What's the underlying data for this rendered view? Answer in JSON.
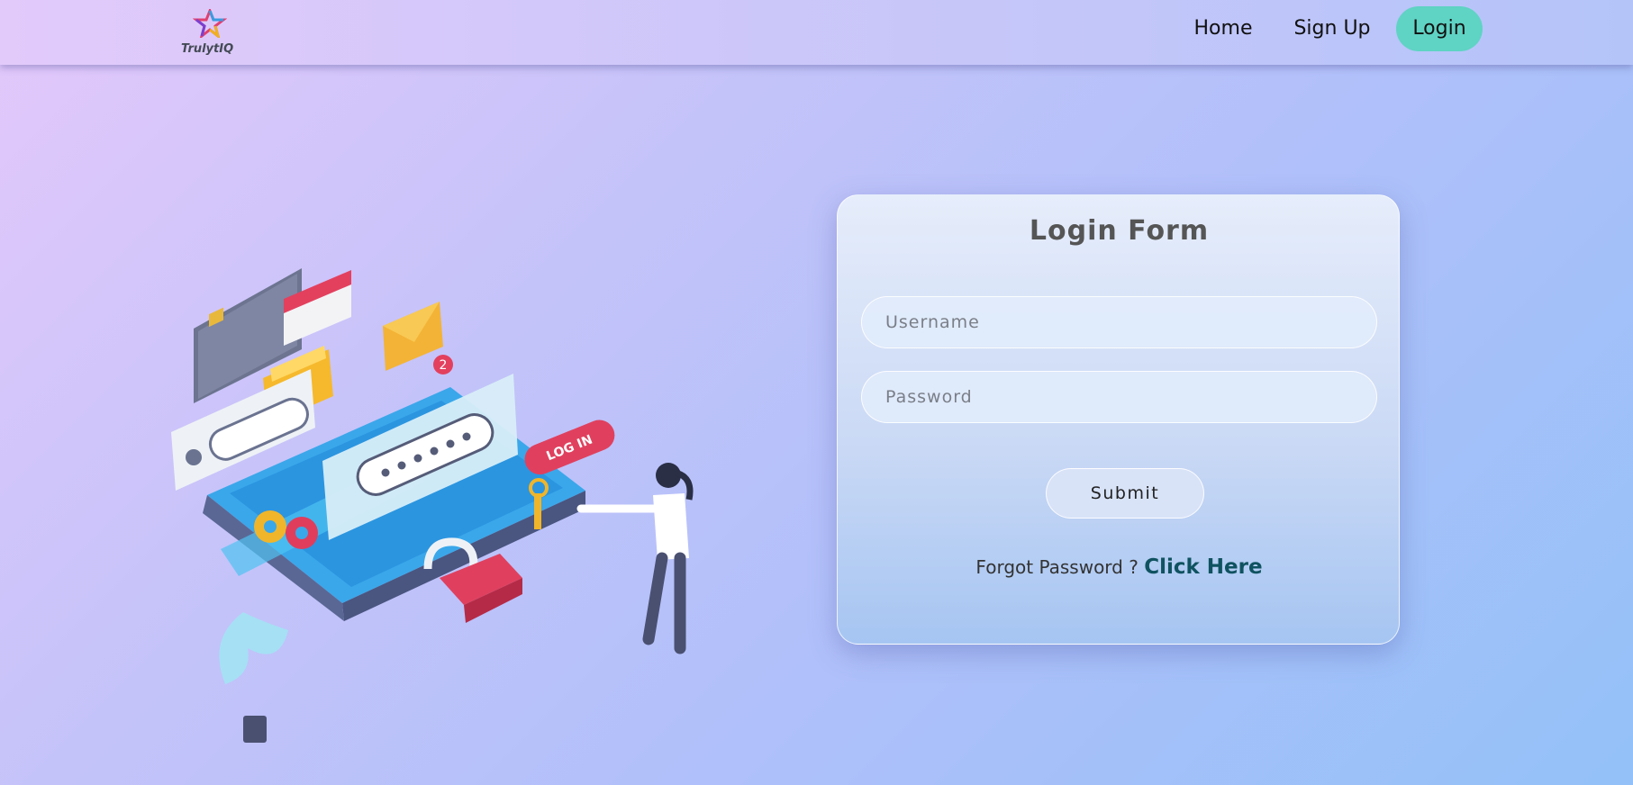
{
  "brand": {
    "name": "TrulytIQ"
  },
  "nav": {
    "home": "Home",
    "signup": "Sign Up",
    "login": "Login",
    "active_color": "#5fd3c4"
  },
  "form": {
    "title": "Login Form",
    "username_placeholder": "Username",
    "password_placeholder": "Password",
    "submit_label": "Submit",
    "forgot_text": "Forgot Password ?",
    "forgot_link": "Click Here"
  },
  "illustration": {
    "login_badge": "LOG IN",
    "notification_count": "2"
  }
}
